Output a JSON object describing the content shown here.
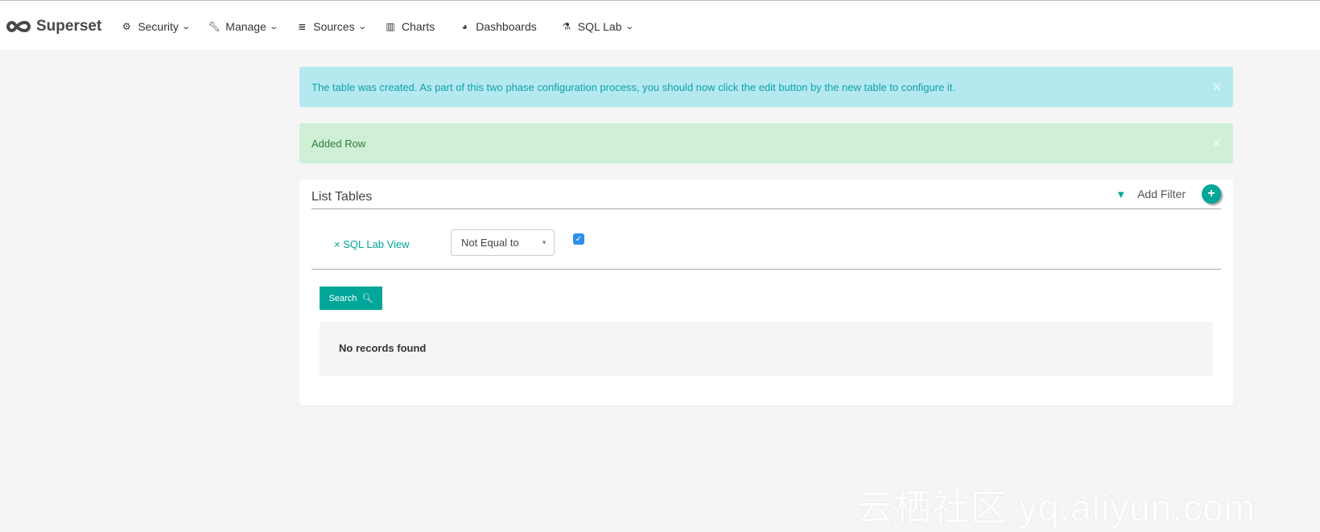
{
  "nav": {
    "brand": "Superset",
    "items": [
      {
        "label": "Security",
        "icon": "gears-icon",
        "dropdown": true
      },
      {
        "label": "Manage",
        "icon": "wrench-icon",
        "dropdown": true
      },
      {
        "label": "Sources",
        "icon": "database-icon",
        "dropdown": true
      },
      {
        "label": "Charts",
        "icon": "bar-chart-icon",
        "dropdown": false
      },
      {
        "label": "Dashboards",
        "icon": "dashboard-icon",
        "dropdown": false
      },
      {
        "label": "SQL Lab",
        "icon": "flask-icon",
        "dropdown": true
      }
    ]
  },
  "alerts": {
    "info": "The table was created. As part of this two phase configuration process, you should now click the edit button by the new table to configure it.",
    "success": "Added Row"
  },
  "panel": {
    "title": "List Tables",
    "add_filter": "Add Filter",
    "filter": {
      "name": "× SQL Lab View",
      "operator": "Not Equal to",
      "checked": true
    },
    "search_label": "Search",
    "empty": "No records found"
  },
  "colors": {
    "accent": "#00a699",
    "info_bg": "#b4e9ef",
    "success_bg": "#cfefd7"
  },
  "watermark": "云栖社区 yq.aliyun.com"
}
